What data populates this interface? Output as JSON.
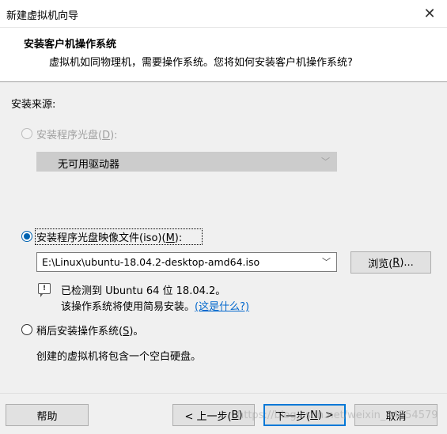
{
  "window": {
    "title": "新建虚拟机向导",
    "close_glyph": "✕"
  },
  "header": {
    "title": "安装客户机操作系统",
    "subtitle": "虚拟机如同物理机，需要操作系统。您将如何安装客户机操作系统?"
  },
  "install_source": {
    "label": "安装来源:",
    "disc_option": {
      "label_prefix": "安装程序光盘(",
      "mnemonic": "D",
      "label_suffix": "):",
      "checked": false,
      "enabled": false,
      "drive_value": "无可用驱动器"
    },
    "iso_option": {
      "label_prefix": "安装程序光盘映像文件(iso)(",
      "mnemonic": "M",
      "label_suffix": "):",
      "checked": true,
      "path": "E:\\Linux\\ubuntu-18.04.2-desktop-amd64.iso",
      "browse_prefix": "浏览(",
      "browse_mnemonic": "R",
      "browse_suffix": ")...",
      "detected_text": "已检测到 Ubuntu 64 位 18.04.2。",
      "easy_install_text": "该操作系统将使用简易安装。",
      "whats_this_link": "(这是什么?)"
    },
    "later_option": {
      "label_prefix": "稍后安装操作系统(",
      "mnemonic": "S",
      "label_suffix": ")。",
      "checked": false,
      "description": "创建的虚拟机将包含一个空白硬盘。"
    }
  },
  "footer": {
    "help_label": "帮助",
    "back_prefix": "< 上一步(",
    "back_mnemonic": "B",
    "back_suffix": ")",
    "next_prefix": "下一步(",
    "next_mnemonic": "N",
    "next_suffix": ") >",
    "cancel_label": "取消"
  },
  "watermark": "https://blog.csdn.net/weixin_44554579",
  "colors": {
    "accent": "#0078d7",
    "link": "#0066cc"
  }
}
